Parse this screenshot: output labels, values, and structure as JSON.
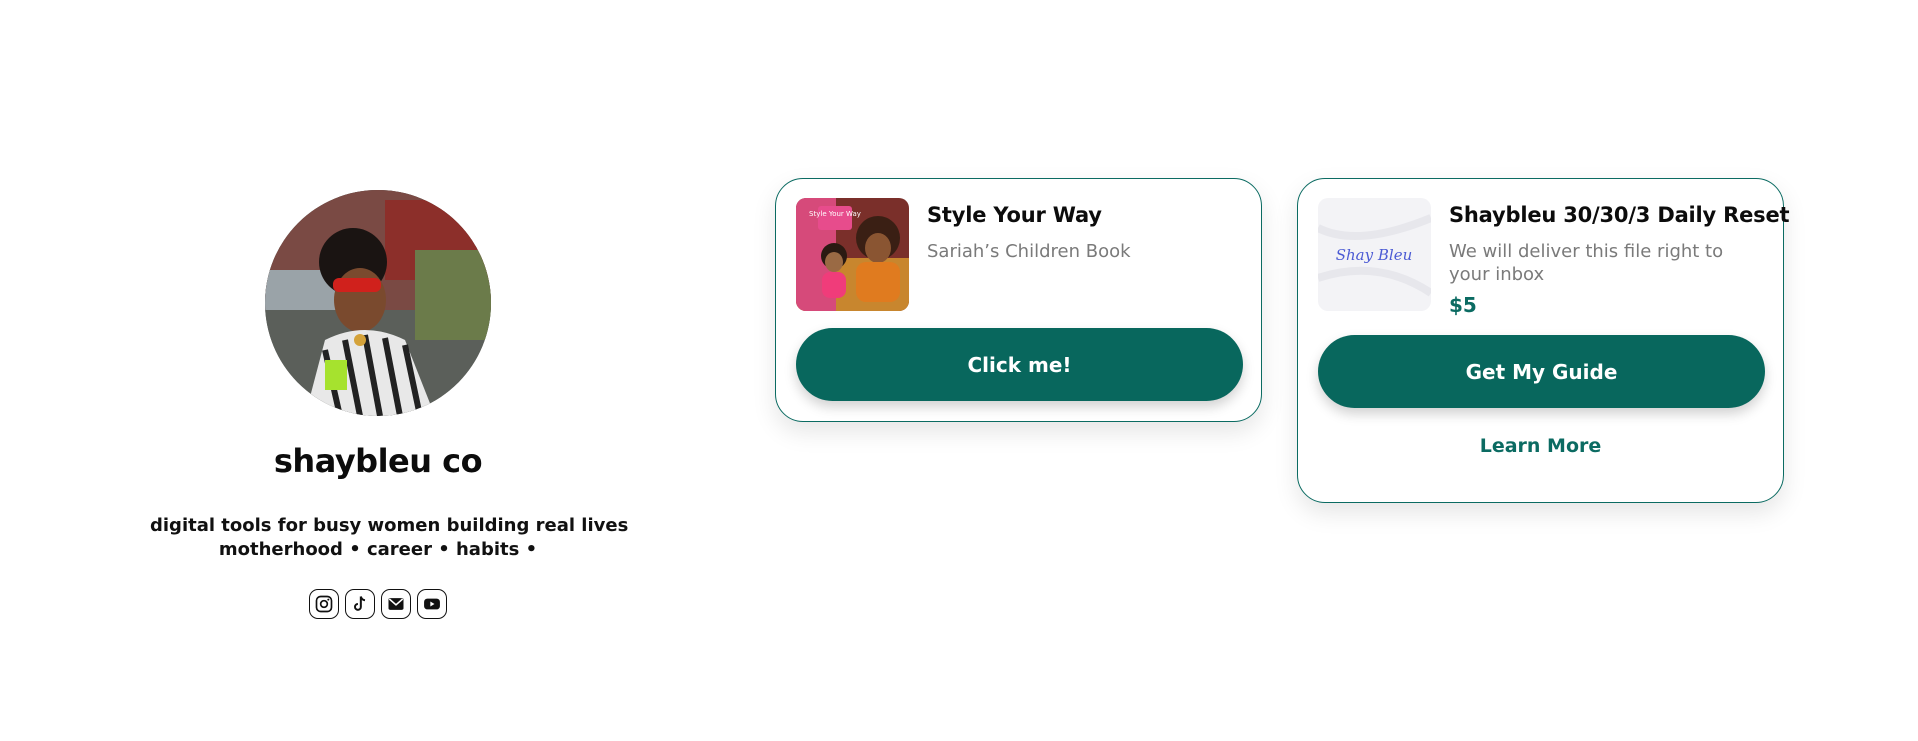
{
  "profile": {
    "name": "shaybleu co",
    "bio_line1": "digital tools for busy women building real lives",
    "bio_line2": "motherhood • career • habits •",
    "socials": [
      "instagram-icon",
      "tiktok-icon",
      "email-icon",
      "youtube-icon"
    ]
  },
  "cards": [
    {
      "title": "Style Your Way",
      "subtitle": "Sariah’s Children Book",
      "button": "Click me!",
      "thumbnail_text": "Style Your Way"
    },
    {
      "title": "Shaybleu 30/30/3 Daily Reset",
      "subtitle": "We will deliver this file right to your inbox",
      "price": "$5",
      "button": "Get My Guide",
      "link": "Learn More",
      "thumbnail_text": "Shay Bleu"
    }
  ],
  "colors": {
    "accent": "#08675d",
    "border": "#0b6b62",
    "muted": "#7a7a7a"
  }
}
